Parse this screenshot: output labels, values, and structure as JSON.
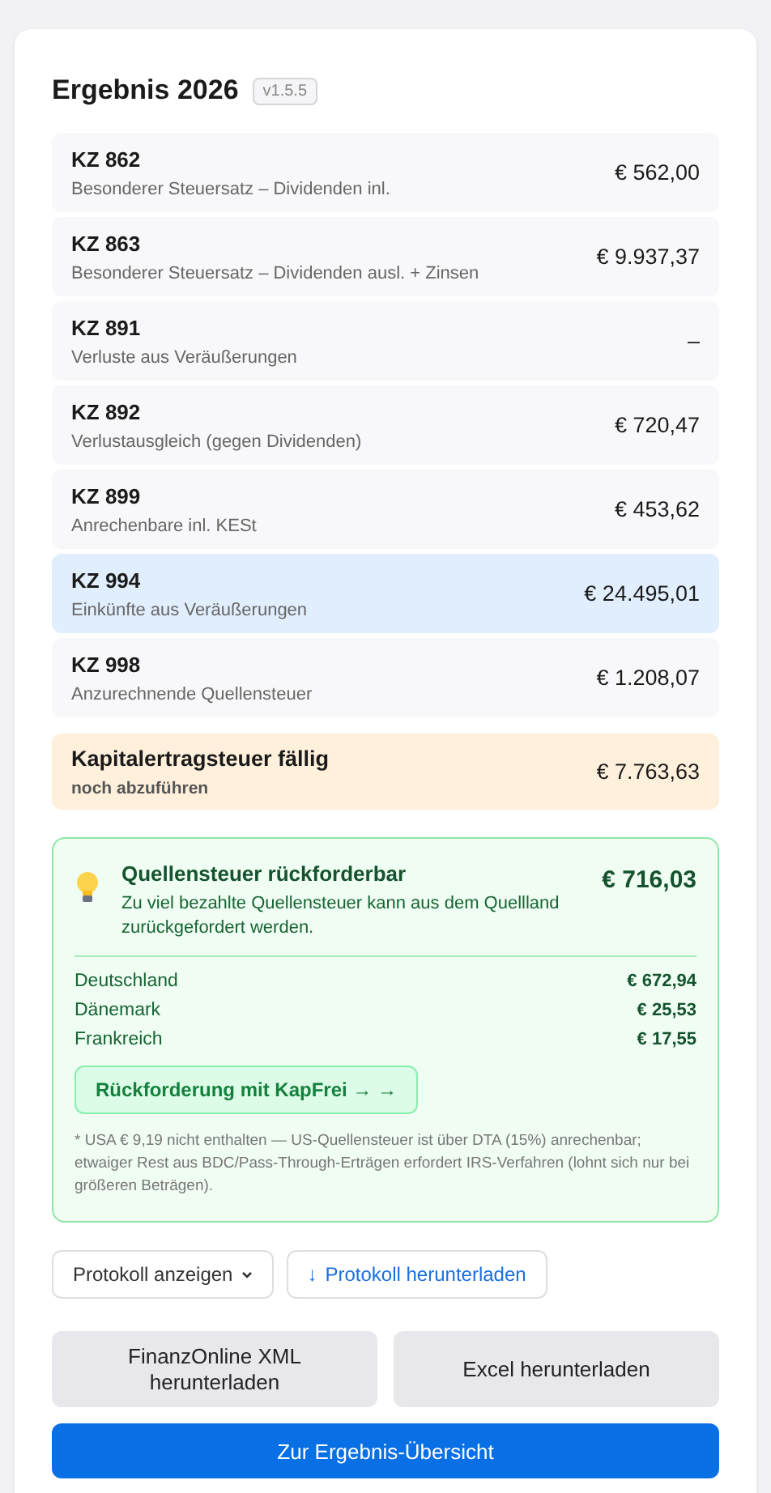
{
  "header": {
    "title": "Ergebnis 2026",
    "version": "v1.5.5"
  },
  "rows": [
    {
      "code": "KZ 862",
      "label": "Besonderer Steuersatz – Dividenden inl.",
      "amount": "€ 562,00",
      "highlighted": false
    },
    {
      "code": "KZ 863",
      "label": "Besonderer Steuersatz – Dividenden ausl. + Zinsen",
      "amount": "€ 9.937,37",
      "highlighted": false
    },
    {
      "code": "KZ 891",
      "label": "Verluste aus Veräußerungen",
      "amount": "–",
      "highlighted": false
    },
    {
      "code": "KZ 892",
      "label": "Verlustausgleich (gegen Dividenden)",
      "amount": "€ 720,47",
      "highlighted": false
    },
    {
      "code": "KZ 899",
      "label": "Anrechenbare inl. KESt",
      "amount": "€ 453,62",
      "highlighted": false
    },
    {
      "code": "KZ 994",
      "label": "Einkünfte aus Veräußerungen",
      "amount": "€ 24.495,01",
      "highlighted": true
    },
    {
      "code": "KZ 998",
      "label": "Anzurechnende Quellensteuer",
      "amount": "€ 1.208,07",
      "highlighted": false
    }
  ],
  "due": {
    "title": "Kapitalertragsteuer fällig",
    "subtitle": "noch abzuführen",
    "amount": "€ 7.763,63"
  },
  "refund": {
    "title": "Quellensteuer rückforderbar",
    "text": "Zu viel bezahlte Quellensteuer kann aus dem Quellland zurückgefordert werden.",
    "amount": "€ 716,03",
    "countries": [
      {
        "name": "Deutschland",
        "amount": "€ 672,94"
      },
      {
        "name": "Dänemark",
        "amount": "€ 25,53"
      },
      {
        "name": "Frankreich",
        "amount": "€ 17,55"
      }
    ],
    "button": "Rückforderung mit KapFrei → →",
    "note": "* USA € 9,19 nicht enthalten — US-Quellensteuer ist über DTA (15%) anrechenbar; etwaiger Rest aus BDC/Pass-Through-Erträgen erfordert IRS-Verfahren (lohnt sich nur bei größeren Beträgen)."
  },
  "protocol": {
    "show": "Protokoll anzeigen",
    "download_icon": "↓",
    "download": "Protokoll herunterladen"
  },
  "downloads": [
    "FinanzOnline XML herunterladen",
    "Excel herunterladen"
  ],
  "primary": "Zur Ergebnis-Übersicht"
}
